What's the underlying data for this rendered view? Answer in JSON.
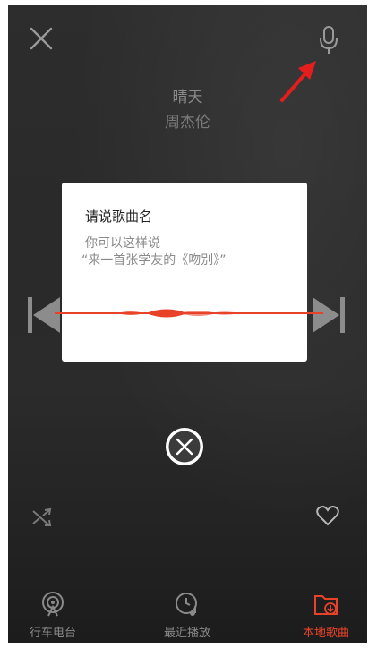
{
  "player": {
    "song_title": "晴天",
    "artist": "周杰伦"
  },
  "icons": {
    "close": "close-icon",
    "mic": "microphone-icon",
    "prev": "skip-previous-icon",
    "next": "skip-next-icon",
    "shuffle": "shuffle-icon",
    "favorite": "heart-icon",
    "cancel": "cancel-icon",
    "annotation": "red-arrow"
  },
  "dialog": {
    "title": "请说歌曲名",
    "hint_line1": "你可以这样说",
    "hint_line2": "“来一首张学友的《吻别》”"
  },
  "tabs": [
    {
      "label": "行车电台",
      "icon": "radio-icon",
      "active": false
    },
    {
      "label": "最近播放",
      "icon": "clock-music-icon",
      "active": false
    },
    {
      "label": "本地歌曲",
      "icon": "folder-download-icon",
      "active": true
    }
  ],
  "colors": {
    "accent": "#e84328",
    "background": "#2a2a2a",
    "muted_text": "#8a8a8a"
  }
}
